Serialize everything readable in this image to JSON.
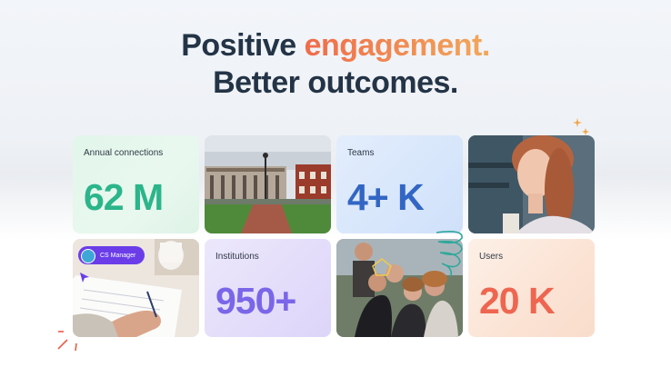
{
  "headline": {
    "line1_prefix": "Positive",
    "line1_accent": "engagement.",
    "line2": "Better outcomes."
  },
  "stats": [
    {
      "label": "Annual connections",
      "value": "62 M",
      "color": "#2bb58a"
    },
    {
      "label": "Teams",
      "value": "4+ K",
      "color": "#3366c4"
    },
    {
      "label": "Institutions",
      "value": "950+",
      "color": "#7a66e8"
    },
    {
      "label": "Users",
      "value": "20 K",
      "color": "#ee6650"
    }
  ],
  "photos": [
    {
      "icon": "campus-building-photo"
    },
    {
      "icon": "young-woman-portrait-photo"
    },
    {
      "icon": "writing-hand-photo"
    },
    {
      "icon": "student-group-photo"
    }
  ],
  "badge": {
    "label": "CS Manager"
  }
}
